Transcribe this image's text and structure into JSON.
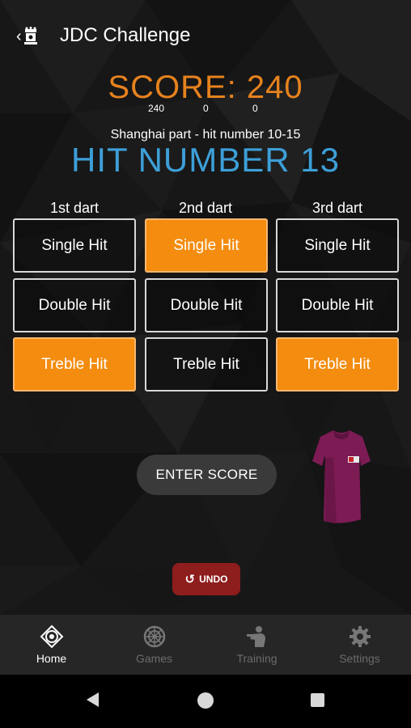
{
  "appbar": {
    "title": "JDC Challenge"
  },
  "score": {
    "label": "SCORE: 240",
    "darts": [
      "240",
      "0",
      "0"
    ]
  },
  "game": {
    "part": "Shanghai part - hit number 10-15",
    "target": "HIT NUMBER 13"
  },
  "darts": [
    {
      "heading": "1st dart",
      "options": [
        "Single Hit",
        "Double Hit",
        "Treble Hit"
      ],
      "selected": "Treble Hit"
    },
    {
      "heading": "2nd dart",
      "options": [
        "Single Hit",
        "Double Hit",
        "Treble Hit"
      ],
      "selected": "Single Hit"
    },
    {
      "heading": "3rd dart",
      "options": [
        "Single Hit",
        "Double Hit",
        "Treble Hit"
      ],
      "selected": "Treble Hit"
    }
  ],
  "actions": {
    "enter_score": "ENTER SCORE",
    "undo": "UNDO"
  },
  "bottom_nav": [
    {
      "label": "Home",
      "icon": "dartboard-target-icon",
      "active": true
    },
    {
      "label": "Games",
      "icon": "dartboard-icon",
      "active": false
    },
    {
      "label": "Training",
      "icon": "training-icon",
      "active": false
    },
    {
      "label": "Settings",
      "icon": "gear-icon",
      "active": false
    }
  ],
  "colors": {
    "score": "#e6821e",
    "target": "#3d9fd8",
    "selected": "#f48c0f",
    "undo": "#8e1d1d",
    "shirt": "#8a1f5c"
  }
}
